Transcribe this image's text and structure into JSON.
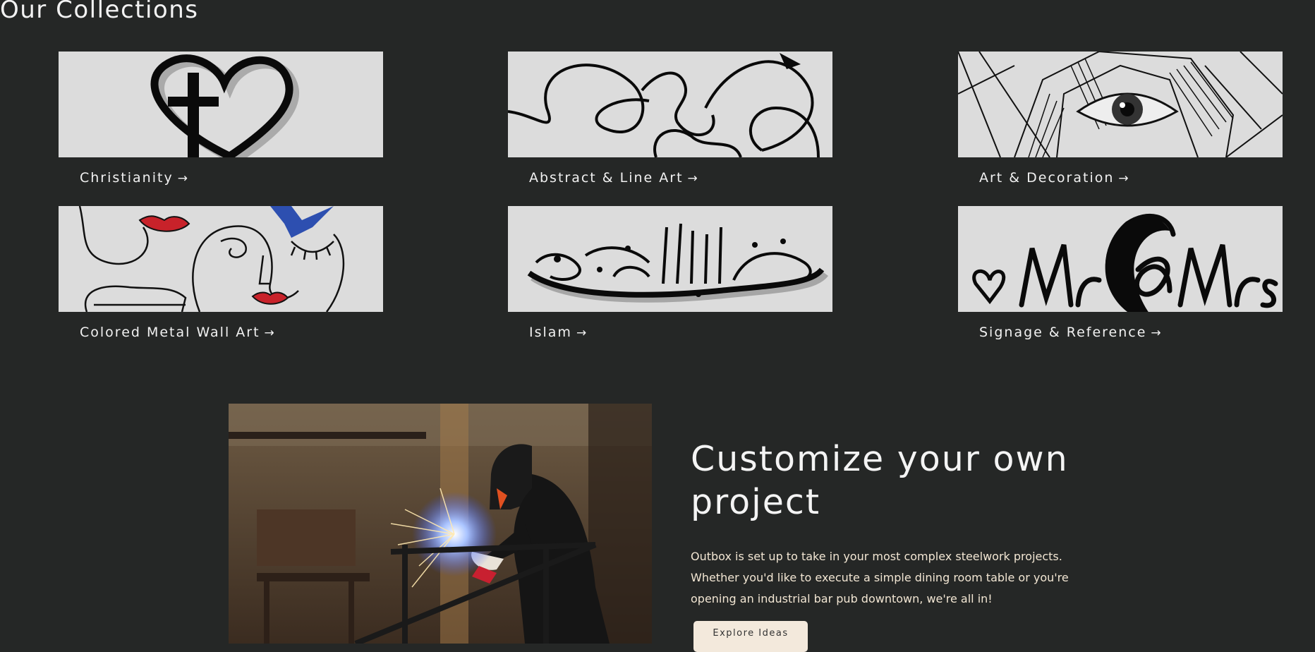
{
  "collections": {
    "title": "Our Collections",
    "items": [
      {
        "label": "Christianity",
        "arrow": "→",
        "icon": "cross-heart-art"
      },
      {
        "label": "Abstract & Line Art",
        "arrow": "→",
        "icon": "abstract-line-faces-art"
      },
      {
        "label": "Art & Decoration",
        "arrow": "→",
        "icon": "geometric-eye-art"
      },
      {
        "label": "Colored Metal Wall Art",
        "arrow": "→",
        "icon": "colored-faces-lips-art"
      },
      {
        "label": "Islam",
        "arrow": "→",
        "icon": "arabic-calligraphy-art"
      },
      {
        "label": "Signage & Reference",
        "arrow": "→",
        "icon": "mr-mrs-sign-art"
      }
    ]
  },
  "promo": {
    "heading": "Customize your own project",
    "body": "Outbox is set up to take in your most complex steelwork projects. Whether you'd like to execute a simple dining room table or you're opening an industrial bar pub downtown, we're all in!",
    "button_label": "Explore Ideas",
    "image": "welder-workshop-photo"
  },
  "colors": {
    "background": "#252726",
    "card_image_bg": "#dcdcdc",
    "button_bg": "#f3e9dc",
    "body_text": "#f2e6d3",
    "accent_red": "#c8222a",
    "accent_blue": "#2d4fb0"
  }
}
